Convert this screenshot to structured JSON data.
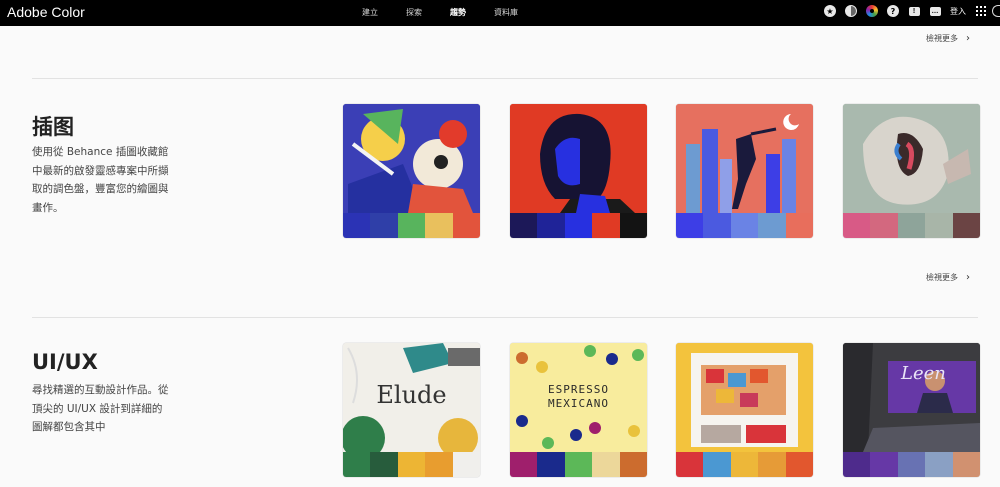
{
  "app": {
    "brand": "Adobe Color"
  },
  "nav": [
    {
      "label": "建立",
      "active": false
    },
    {
      "label": "探索",
      "active": false
    },
    {
      "label": "趨勢",
      "active": true
    },
    {
      "label": "資料庫",
      "active": false
    }
  ],
  "toolbar": {
    "signin_label": "登入"
  },
  "view_more_label": "檢視更多",
  "sections": [
    {
      "title": "插图",
      "description": "使用從 Behance 插圖收藏館中最新的啟發靈感專案中所擷取的調色盤，豐富您的繪圖與畫作。",
      "cards": [
        {
          "palette": [
            "#2b33b5",
            "#2f3fa8",
            "#58b45d",
            "#e9c05d",
            "#e2543c"
          ]
        },
        {
          "palette": [
            "#1c1858",
            "#1f2398",
            "#2730e0",
            "#e03a24",
            "#131313"
          ]
        },
        {
          "palette": [
            "#3d3ee6",
            "#4b5ae0",
            "#6a83e5",
            "#6d9bd1",
            "#e86e5c"
          ]
        },
        {
          "palette": [
            "#d85a86",
            "#d3687f",
            "#8ea49a",
            "#a8b5a8",
            "#6b4444"
          ]
        }
      ]
    },
    {
      "title": "UI/UX",
      "description": "尋找精選的互動設計作品。從頂尖的 UI/UX 設計到詳細的圖解都包含其中",
      "cards": [
        {
          "art_text": "Elude",
          "palette": [
            "#2f7e4a",
            "#275c3c",
            "#edb534",
            "#e89d2f",
            "#f0efec"
          ]
        },
        {
          "art_text": "ESPRESSO MEXICANO",
          "palette": [
            "#9f1f6c",
            "#1a2a8c",
            "#5cb858",
            "#ecd79a",
            "#cc6c2e"
          ]
        },
        {
          "palette": [
            "#d9343a",
            "#4b98d2",
            "#edb739",
            "#e69b37",
            "#e2572e"
          ]
        },
        {
          "art_text": "Leen",
          "palette": [
            "#4e2b8c",
            "#6638a6",
            "#6872b3",
            "#8aa0c4",
            "#d19170"
          ]
        }
      ]
    }
  ]
}
